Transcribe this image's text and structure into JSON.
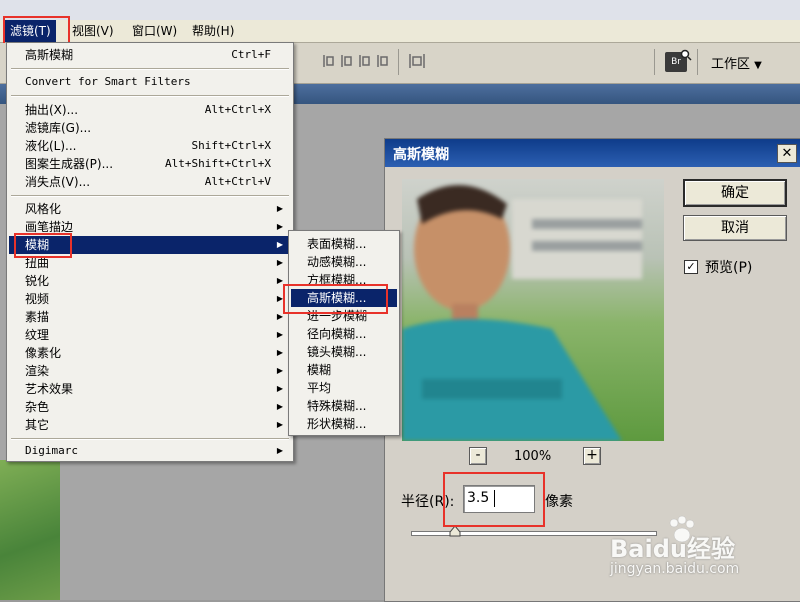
{
  "menubar": {
    "items": [
      "滤镜(T)",
      "视图(V)",
      "窗口(W)",
      "帮助(H)"
    ]
  },
  "optbar": {
    "bridge_icon_label": "Br",
    "workspace_label": "工作区"
  },
  "filter_menu": {
    "rows": [
      {
        "label": "高斯模糊",
        "shortcut": "Ctrl+F"
      },
      {
        "label": "Convert for Smart Filters",
        "shortcut": ""
      },
      {
        "label": "抽出(X)...",
        "shortcut": "Alt+Ctrl+X"
      },
      {
        "label": "滤镜库(G)...",
        "shortcut": ""
      },
      {
        "label": "液化(L)...",
        "shortcut": "Shift+Ctrl+X"
      },
      {
        "label": "图案生成器(P)...",
        "shortcut": "Alt+Shift+Ctrl+X"
      },
      {
        "label": "消失点(V)...",
        "shortcut": "Alt+Ctrl+V"
      },
      {
        "label": "风格化"
      },
      {
        "label": "画笔描边"
      },
      {
        "label": "模糊"
      },
      {
        "label": "扭曲"
      },
      {
        "label": "锐化"
      },
      {
        "label": "视频"
      },
      {
        "label": "素描"
      },
      {
        "label": "纹理"
      },
      {
        "label": "像素化"
      },
      {
        "label": "渲染"
      },
      {
        "label": "艺术效果"
      },
      {
        "label": "杂色"
      },
      {
        "label": "其它"
      },
      {
        "label": "Digimarc"
      }
    ]
  },
  "blur_submenu": {
    "items": [
      "表面模糊...",
      "动感模糊...",
      "方框模糊...",
      "高斯模糊...",
      "进一步模糊",
      "径向模糊...",
      "镜头模糊...",
      "模糊",
      "平均",
      "特殊模糊...",
      "形状模糊..."
    ]
  },
  "dialog": {
    "title": "高斯模糊",
    "ok_label": "确定",
    "cancel_label": "取消",
    "preview_label": "预览(P)",
    "preview_checked": true,
    "zoom_out": "-",
    "zoom_in": "+",
    "zoom_level": "100%",
    "radius_label": "半径(R):",
    "radius_value": "3.5",
    "radius_unit": "像素"
  },
  "watermark": {
    "brand": "Baidu经验",
    "url": "jingyan.baidu.com"
  },
  "colors": {
    "menu_highlight": "#0a246a",
    "annotation_red": "#e8322a",
    "title_blue": "#0e3c8a"
  }
}
